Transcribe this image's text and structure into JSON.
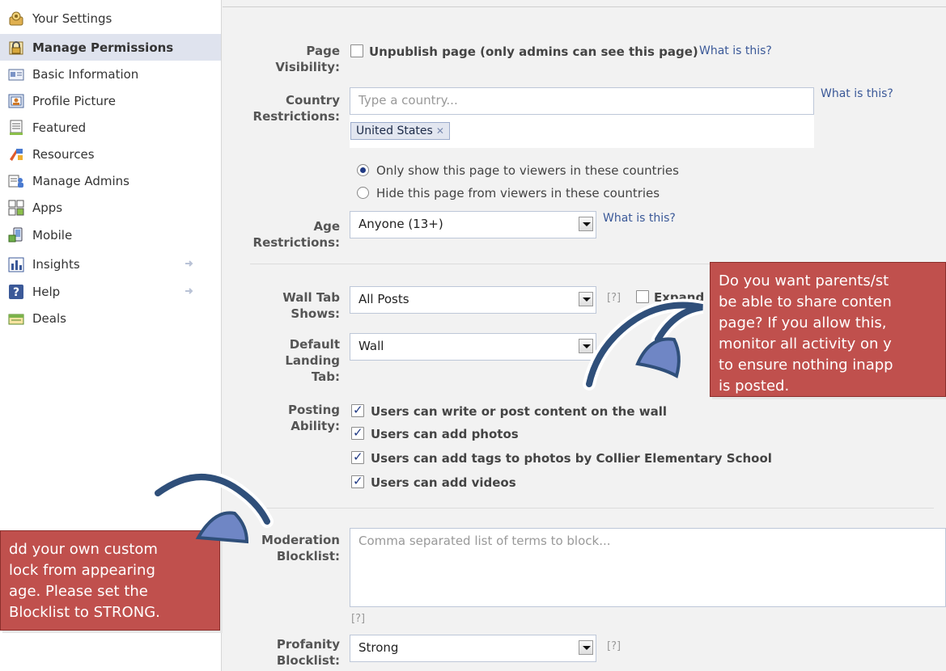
{
  "sidebar": {
    "items": [
      {
        "label": "Your Settings",
        "icon": "settings-icon",
        "active": false
      },
      {
        "label": "Manage Permissions",
        "icon": "lock-icon",
        "active": true
      },
      {
        "label": "Basic Information",
        "icon": "info-card-icon",
        "active": false
      },
      {
        "label": "Profile Picture",
        "icon": "picture-icon",
        "active": false
      },
      {
        "label": "Featured",
        "icon": "featured-icon",
        "active": false
      },
      {
        "label": "Resources",
        "icon": "resources-icon",
        "active": false
      },
      {
        "label": "Manage Admins",
        "icon": "admins-icon",
        "active": false
      },
      {
        "label": "Apps",
        "icon": "apps-icon",
        "active": false
      },
      {
        "label": "Mobile",
        "icon": "mobile-icon",
        "active": false
      },
      {
        "label": "Insights",
        "icon": "insights-icon",
        "active": false
      },
      {
        "label": "Help",
        "icon": "help-icon",
        "active": false
      },
      {
        "label": "Deals",
        "icon": "deals-icon",
        "active": false
      }
    ]
  },
  "form": {
    "page_visibility": {
      "label_1": "Page",
      "label_2": "Visibility:",
      "checkbox_label": "Unpublish page (only admins can see this page)",
      "link": "What is this?"
    },
    "country_restrictions": {
      "label_1": "Country",
      "label_2": "Restrictions:",
      "placeholder": "Type a country...",
      "token": "United States",
      "link": "What is this?",
      "option_show": "Only show this page to viewers in these countries",
      "option_hide": "Hide this page from viewers in these countries"
    },
    "age_restrictions": {
      "label_1": "Age",
      "label_2": "Restrictions:",
      "value": "Anyone (13+)",
      "link": "What is this?"
    },
    "wall_tab": {
      "label_1": "Wall Tab",
      "label_2": "Shows:",
      "value": "All Posts",
      "help": "[?]",
      "expand_label": "Expand"
    },
    "default_landing": {
      "label_1": "Default",
      "label_2": "Landing",
      "label_3": "Tab:",
      "value": "Wall"
    },
    "posting_ability": {
      "label_1": "Posting",
      "label_2": "Ability:",
      "options": [
        "Users can write or post content on the wall",
        "Users can add photos",
        "Users can add tags to photos by Collier Elementary School",
        "Users can add videos"
      ]
    },
    "moderation": {
      "label_1": "Moderation",
      "label_2": "Blocklist:",
      "placeholder": "Comma separated list of terms to block...",
      "help": "[?]"
    },
    "profanity": {
      "label_1": "Profanity",
      "label_2": "Blocklist:",
      "value": "Strong",
      "help": "[?]"
    }
  },
  "callouts": {
    "right": "Do you want parents/st\nbe able to share conten\npage? If you allow this,\nmonitor all activity on y\nto ensure nothing inapp\nis posted.",
    "left": "dd your own custom\nlock from appearing\nage. Please set the\nBlocklist to STRONG."
  },
  "colors": {
    "link": "#3b5998",
    "callout": "#c0504d",
    "active_nav": "#dfe3ee"
  }
}
